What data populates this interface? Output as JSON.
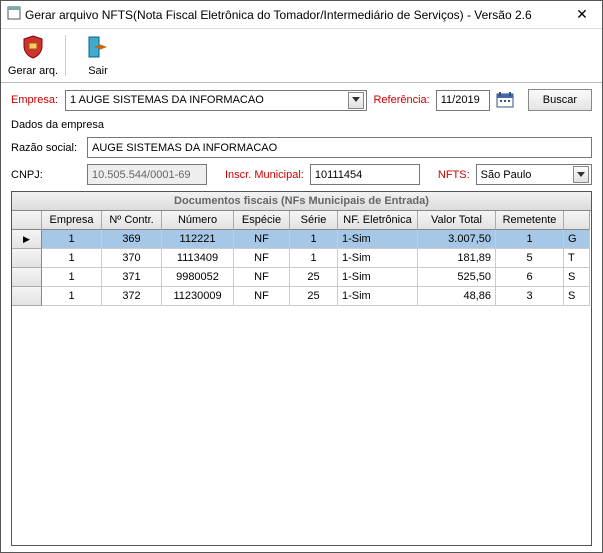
{
  "title": "Gerar arquivo NFTS(Nota Fiscal Eletrônica do Tomador/Intermediário de Serviços) - Versão 2.6",
  "toolbar": {
    "gerar": "Gerar arq.",
    "sair": "Sair"
  },
  "labels": {
    "empresa": "Empresa:",
    "referencia": "Referência:",
    "dados": "Dados da empresa",
    "razao": "Razão social:",
    "cnpj": "CNPJ:",
    "inscr": "Inscr. Municipal:",
    "nfts": "NFTS:",
    "buscar": "Buscar"
  },
  "empresa_combo": "1  AUGE SISTEMAS DA INFORMACAO",
  "referencia": "11/2019",
  "razao_social": "AUGE SISTEMAS DA INFORMACAO",
  "cnpj": "10.505.544/0001-69",
  "inscr_municipal": "10111454",
  "nfts_combo": "São Paulo",
  "grid": {
    "title": "Documentos fiscais (NFs Municipais de Entrada)",
    "headers": [
      "",
      "Empresa",
      "Nº Contr.",
      "Número",
      "Espécie",
      "Série",
      "NF. Eletrônica",
      "Valor Total",
      "Remetente",
      ""
    ],
    "rows": [
      {
        "sel": true,
        "empresa": "1",
        "contr": "369",
        "numero": "112221",
        "especie": "NF",
        "serie": "1",
        "nfe": "1-Sim",
        "valor": "3.007,50",
        "rem": "1",
        "extra": "G"
      },
      {
        "sel": false,
        "empresa": "1",
        "contr": "370",
        "numero": "1113409",
        "especie": "NF",
        "serie": "1",
        "nfe": "1-Sim",
        "valor": "181,89",
        "rem": "5",
        "extra": "T"
      },
      {
        "sel": false,
        "empresa": "1",
        "contr": "371",
        "numero": "9980052",
        "especie": "NF",
        "serie": "25",
        "nfe": "1-Sim",
        "valor": "525,50",
        "rem": "6",
        "extra": "S"
      },
      {
        "sel": false,
        "empresa": "1",
        "contr": "372",
        "numero": "11230009",
        "especie": "NF",
        "serie": "25",
        "nfe": "1-Sim",
        "valor": "48,86",
        "rem": "3",
        "extra": "S"
      }
    ]
  }
}
